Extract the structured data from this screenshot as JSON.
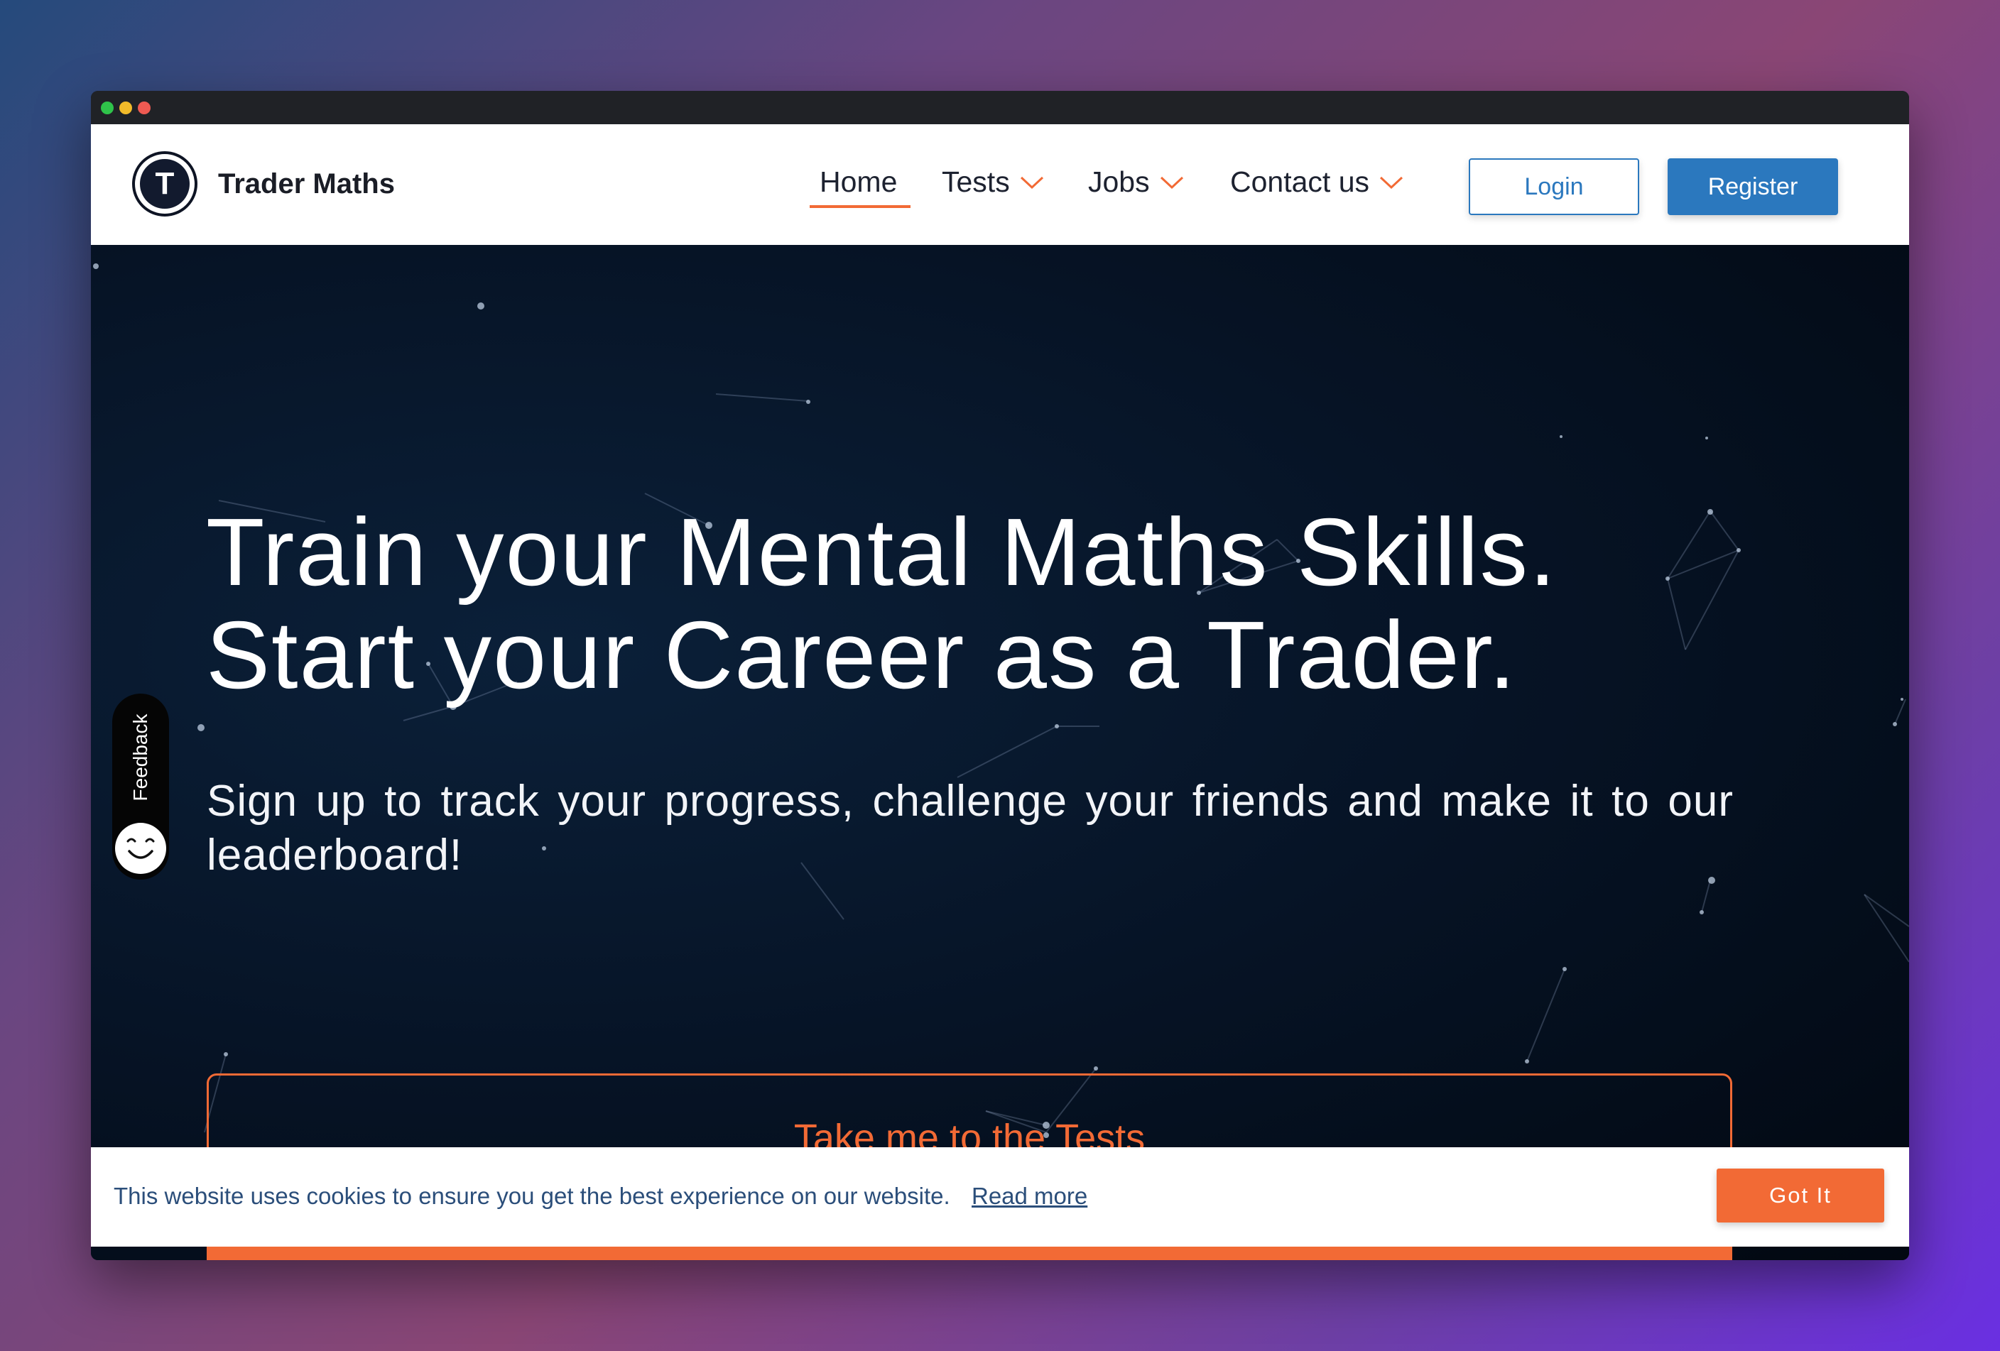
{
  "brand": {
    "logo_letter": "T",
    "name": "Trader Maths"
  },
  "nav": {
    "home": "Home",
    "tests": "Tests",
    "jobs": "Jobs",
    "contact": "Contact us"
  },
  "auth": {
    "login": "Login",
    "register": "Register"
  },
  "hero": {
    "headline_line1": "Train your Mental Maths Skills.",
    "headline_line2": "Start your Career as a Trader.",
    "subline": "Sign up to track your progress, challenge your friends and make it to our leaderboard!",
    "cta_tests": "Take me to the Tests"
  },
  "feedback": {
    "label": "Feedback"
  },
  "cookie": {
    "text": "This website uses cookies to ensure you get the best experience on our website.",
    "link": "Read more",
    "button": "Got It"
  },
  "colors": {
    "accent": "#f26a35",
    "primary_blue": "#2b78be",
    "hero_bg": "#061325"
  }
}
